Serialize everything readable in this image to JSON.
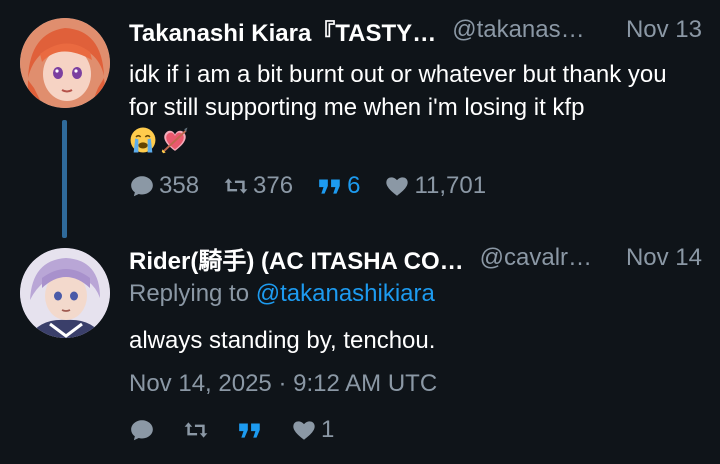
{
  "tweets": [
    {
      "display_name": "Takanashi Kiara『TASTY…",
      "handle": "@takanas…",
      "date": "Nov 13",
      "text": "idk if i am a bit burnt out or whatever but thank you for still supporting me when i'm losing it kfp",
      "emojis": [
        "loudly-crying-face",
        "heart-with-arrow"
      ],
      "replies": "358",
      "retweets": "376",
      "quotes": "6",
      "likes": "11,701"
    },
    {
      "display_name": "Rider(騎手) (AC ITASHA CO…",
      "handle": "@cavalr…",
      "date": "Nov 14",
      "replying_label": "Replying to",
      "replying_handle": "@takanashikiara",
      "text": "always standing by, tenchou.",
      "timestamp": "Nov 14, 2025 · 9:12 AM UTC",
      "replies": "",
      "retweets": "",
      "quotes": "",
      "likes": "1"
    }
  ],
  "colors": {
    "background": "#0f1419",
    "text": "#ffffff",
    "secondary": "#8b98a5",
    "accent": "#1d9bf0",
    "thread_line": "#2f6a9a"
  },
  "icons": {
    "reply": "speech-bubble-icon",
    "retweet": "retweet-icon",
    "quote": "quote-icon",
    "like": "heart-icon"
  }
}
